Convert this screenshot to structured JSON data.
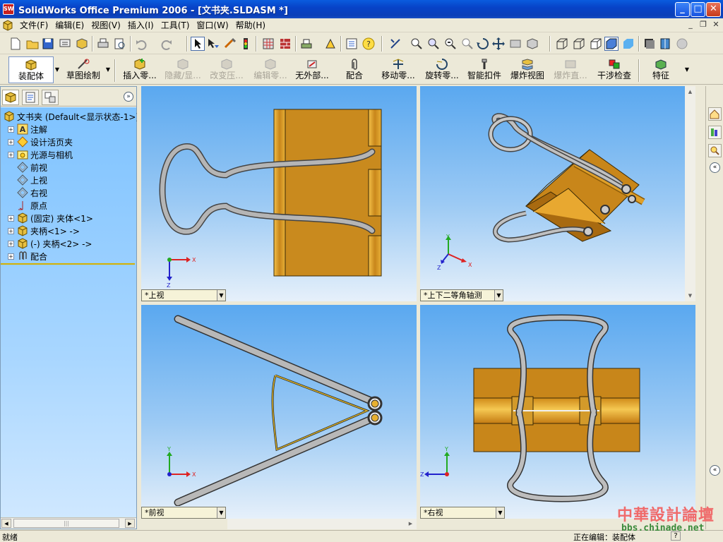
{
  "window": {
    "title": "SolidWorks Office Premium 2006 - [文书夹.SLDASM *]",
    "app_icon_text": "SW",
    "controls": [
      "minimize",
      "maximize",
      "close"
    ]
  },
  "menubar": {
    "items": [
      "文件(F)",
      "编辑(E)",
      "视图(V)",
      "插入(I)",
      "工具(T)",
      "窗口(W)",
      "帮助(H)"
    ]
  },
  "command_manager": {
    "items": [
      {
        "label": "装配体",
        "enabled": true
      },
      {
        "label": "草图绘制",
        "enabled": true
      },
      {
        "label": "插入零...",
        "enabled": true
      },
      {
        "label": "隐藏/显...",
        "enabled": false
      },
      {
        "label": "改变压...",
        "enabled": false
      },
      {
        "label": "编辑零...",
        "enabled": false
      },
      {
        "label": "无外部...",
        "enabled": true
      },
      {
        "label": "配合",
        "enabled": true
      },
      {
        "label": "移动零...",
        "enabled": true
      },
      {
        "label": "旋转零...",
        "enabled": true
      },
      {
        "label": "智能扣件",
        "enabled": true
      },
      {
        "label": "爆炸视图",
        "enabled": true
      },
      {
        "label": "爆炸直...",
        "enabled": false
      },
      {
        "label": "干涉检查",
        "enabled": true
      },
      {
        "label": "特征",
        "enabled": true
      }
    ]
  },
  "feature_tree": {
    "root": "文书夹  (Default<显示状态-1>)",
    "nodes": [
      {
        "label": "注解",
        "icon": "annotation-icon",
        "expandable": true
      },
      {
        "label": "设计活页夹",
        "icon": "design-binder-icon",
        "expandable": true
      },
      {
        "label": "光源与相机",
        "icon": "lights-camera-icon",
        "expandable": true
      },
      {
        "label": "前视",
        "icon": "plane-icon",
        "expandable": false
      },
      {
        "label": "上视",
        "icon": "plane-icon",
        "expandable": false
      },
      {
        "label": "右视",
        "icon": "plane-icon",
        "expandable": false
      },
      {
        "label": "原点",
        "icon": "origin-icon",
        "expandable": false
      },
      {
        "label": "(固定) 夹体<1>",
        "icon": "part-icon",
        "expandable": true
      },
      {
        "label": "夹柄<1> ->",
        "icon": "part-icon",
        "expandable": true
      },
      {
        "label": "(-) 夹柄<2> ->",
        "icon": "part-icon",
        "expandable": true
      },
      {
        "label": "配合",
        "icon": "mates-icon",
        "expandable": true
      }
    ]
  },
  "viewports": {
    "top_left": {
      "label": "*上视"
    },
    "top_right": {
      "label": "*上下二等角轴测"
    },
    "bottom_left": {
      "label": "*前视"
    },
    "bottom_right": {
      "label": "*右视"
    }
  },
  "axes": {
    "x": "X",
    "y": "Y",
    "z": "Z"
  },
  "statusbar": {
    "status": "就绪",
    "editing": "正在编辑：装配体",
    "help": "?"
  },
  "watermark": {
    "line1": "中華設計論壇",
    "line2": "bbs.chinade.net"
  },
  "colors": {
    "title_bar": "#0a5cde",
    "clip_body": "#c8861a",
    "handle": "#a9a9a9",
    "tree_bg": "#8ecbff"
  }
}
